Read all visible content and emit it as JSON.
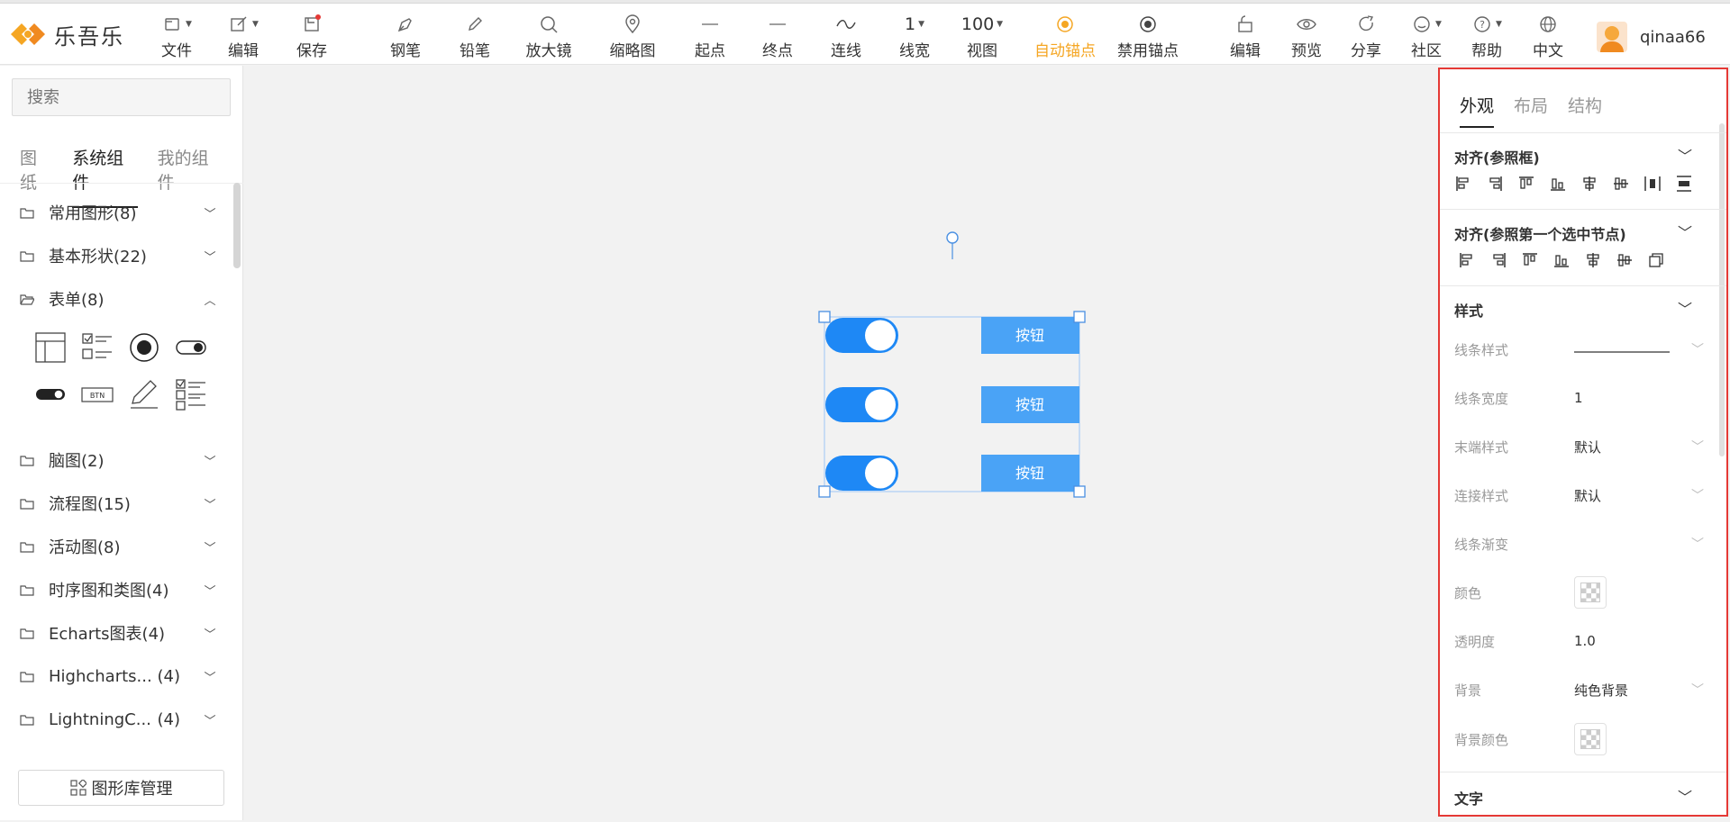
{
  "app": {
    "name": "乐吾乐"
  },
  "toolbar": {
    "file": "文件",
    "edit": "编辑",
    "save": "保存",
    "pen": "钢笔",
    "pencil": "铅笔",
    "magnifier": "放大镜",
    "thumbnail": "缩略图",
    "start": "起点",
    "end": "终点",
    "connect": "连线",
    "line_width_value": "1",
    "line_width": "线宽",
    "zoom_value": "100",
    "view": "视图",
    "auto_anchor": "自动锚点",
    "disable_anchor": "禁用锚点",
    "edit2": "编辑",
    "preview": "预览",
    "share": "分享",
    "community": "社区",
    "help": "帮助",
    "language": "中文",
    "username": "qinaa66"
  },
  "sidebar": {
    "search_placeholder": "搜索",
    "tabs": [
      "图纸",
      "系统组件",
      "我的组件"
    ],
    "categories": [
      "常用图形(8)",
      "基本形状(22)",
      "表单(8)",
      "脑图(2)",
      "流程图(15)",
      "活动图(8)",
      "时序图和类图(4)",
      "Echarts图表(4)",
      "Highcharts...",
      "LightningC...",
      "(4)"
    ],
    "btn_label": "BTN",
    "library_button": "图形库管理"
  },
  "canvas": {
    "button_labels": [
      "按钮",
      "按钮",
      "按钮"
    ],
    "accent_color": "#1e88f5",
    "button_color": "#4aa3f6"
  },
  "panel": {
    "tabs": [
      "外观",
      "布局",
      "结构"
    ],
    "align_frame": "对齐(参照框)",
    "align_first": "对齐(参照第一个选中节点)",
    "style": "样式",
    "props": {
      "line_style": "线条样式",
      "line_width": "线条宽度",
      "line_width_value": "1",
      "end_style": "末端样式",
      "end_style_value": "默认",
      "join_style": "连接样式",
      "join_style_value": "默认",
      "gradient": "线条渐变",
      "color": "颜色",
      "opacity": "透明度",
      "opacity_value": "1.0",
      "background": "背景",
      "background_value": "纯色背景",
      "bg_color": "背景颜色"
    },
    "text": "文字",
    "highlight_color": "#e53935",
    "active_color": "#f5a623"
  }
}
